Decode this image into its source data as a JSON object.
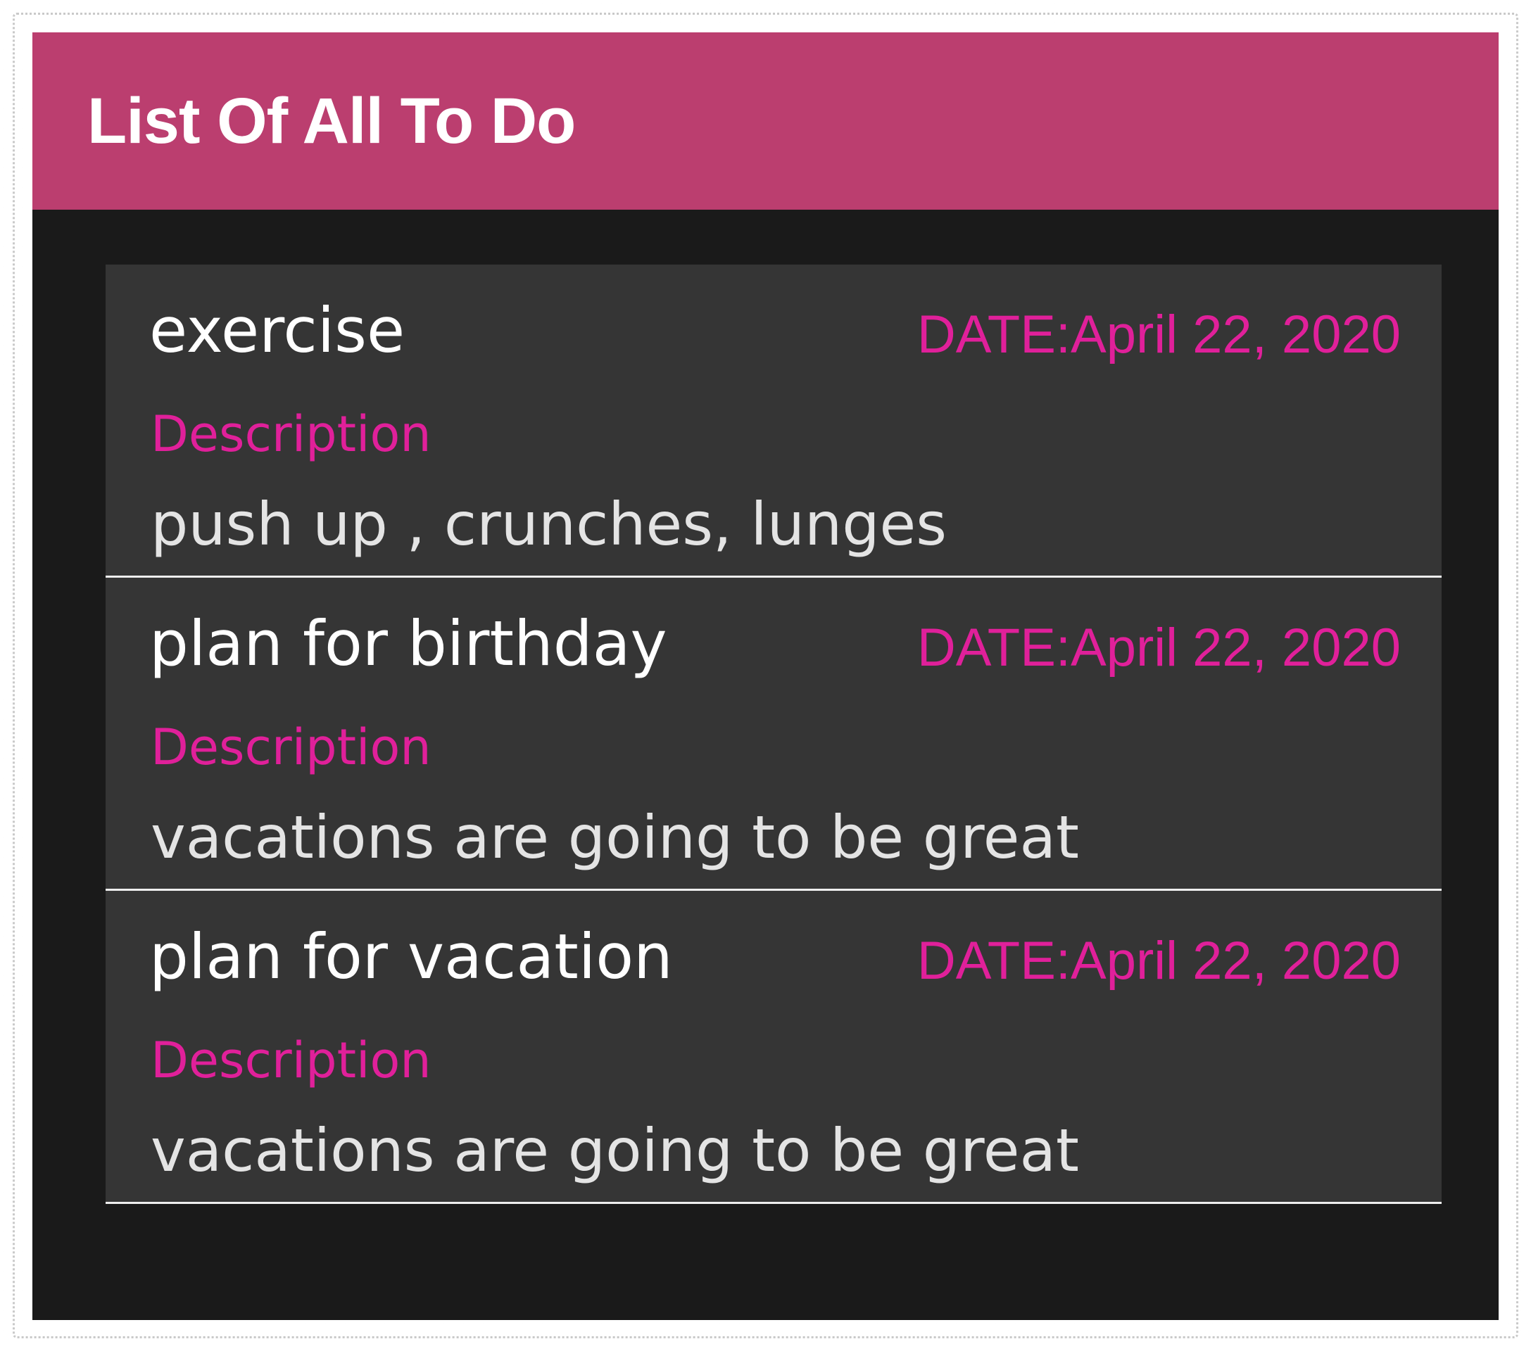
{
  "app_bar": {
    "title": "List Of All To Do"
  },
  "colors": {
    "app_bar": "#bb3e6f",
    "accent": "#e0209a",
    "background": "#1a1a1a",
    "card": "#353535"
  },
  "todos": [
    {
      "title": "exercise",
      "date": "DATE:April 22, 2020",
      "description_label": "Description",
      "description": "push up , crunches, lunges"
    },
    {
      "title": "plan for birthday",
      "date": "DATE:April 22, 2020",
      "description_label": "Description",
      "description": "vacations are going to be great"
    },
    {
      "title": "plan for vacation",
      "date": "DATE:April 22, 2020",
      "description_label": "Description",
      "description": "vacations are going to be great"
    }
  ]
}
